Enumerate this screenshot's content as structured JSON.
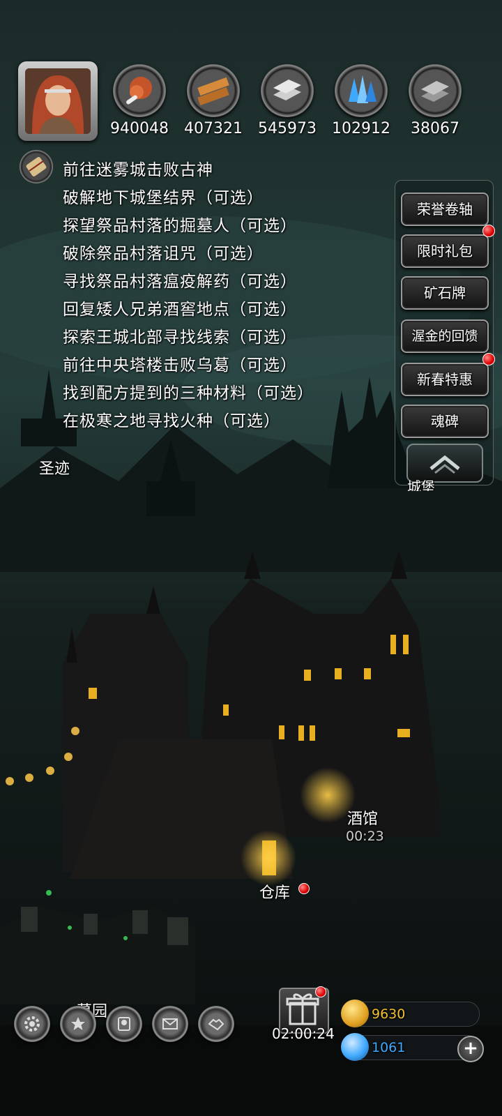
{
  "resources": [
    {
      "name": "meat-icon",
      "value": "940048"
    },
    {
      "name": "wood-icon",
      "value": "407321"
    },
    {
      "name": "iron-icon",
      "value": "545973"
    },
    {
      "name": "crystal-icon",
      "value": "102912"
    },
    {
      "name": "stone-icon",
      "value": "38067"
    }
  ],
  "quests": [
    "前往迷雾城击败古神",
    "破解地下城堡结界（可选）",
    "探望祭品村落的掘墓人（可选）",
    "破除祭品村落诅咒（可选）",
    "寻找祭品村落瘟疫解药（可选）",
    "回复矮人兄弟酒窖地点（可选）",
    "探索王城北部寻找线索（可选）",
    "前往中央塔楼击败乌葛（可选）",
    "找到配方提到的三种材料（可选）",
    "在极寒之地寻找火种（可选）"
  ],
  "side_menu": [
    {
      "label": "荣誉卷轴",
      "badge": false
    },
    {
      "label": "限时礼包",
      "badge": true
    },
    {
      "label": "矿石牌",
      "badge": false
    },
    {
      "label": "渥金的回馈",
      "badge": false
    },
    {
      "label": "新春特惠",
      "badge": true
    },
    {
      "label": "魂碑",
      "badge": false
    }
  ],
  "places": {
    "shengji": "圣迹",
    "chengbao": "城堡",
    "tavern": "酒馆",
    "tavern_timer": "00:23",
    "warehouse": "仓库",
    "graveyard": "墓园"
  },
  "bottom_bar": {
    "icons": [
      "gear-icon",
      "star-icon",
      "hero-icon",
      "mail-icon",
      "handshake-icon"
    ],
    "gift_timer": "02:00:24",
    "gold": "9630",
    "gems": "1061"
  },
  "colors": {
    "text": "#ffffff",
    "badge_red": "#e00000",
    "gold": "#f0c030",
    "gem": "#3fa9ff"
  }
}
